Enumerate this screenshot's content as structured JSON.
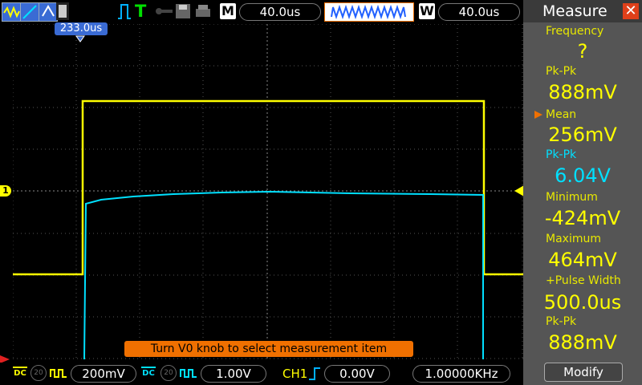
{
  "topbar": {
    "trigger_mode": "T",
    "memory_label": "M",
    "main_timebase": "40.0us",
    "window_label": "W",
    "window_timebase": "40.0us",
    "trigger_time": "233.0us"
  },
  "measure_panel": {
    "title": "Measure",
    "items": [
      {
        "label": "Frequency",
        "value": "?"
      },
      {
        "label": "Pk-Pk",
        "value": "888mV"
      },
      {
        "label": "Mean",
        "value": "256mV",
        "selected": true
      },
      {
        "label": "Pk-Pk",
        "value": "6.04V",
        "cyan": true
      },
      {
        "label": "Minimum",
        "value": "-424mV"
      },
      {
        "label": "Maximum",
        "value": "464mV"
      },
      {
        "label": "+Pulse Width",
        "value": "500.0us"
      },
      {
        "label": "Pk-Pk",
        "value": "888mV"
      }
    ],
    "modify_label": "Modify"
  },
  "bottombar": {
    "ch1_coupling": "DC",
    "ch1_scale": "200mV",
    "ch2_coupling": "DC",
    "ch2_scale": "1.00V",
    "trigger_source": "CH1",
    "trigger_level": "0.00V",
    "frequency": "1.00000KHz",
    "bw_label": "20"
  },
  "hint_text": "Turn V0 knob to select measurement item",
  "channel_marker": "1",
  "colors": {
    "ch1": "#ffff00",
    "ch2": "#00e0ff",
    "accent_orange": "#f07000",
    "panel_bg": "#555555"
  }
}
